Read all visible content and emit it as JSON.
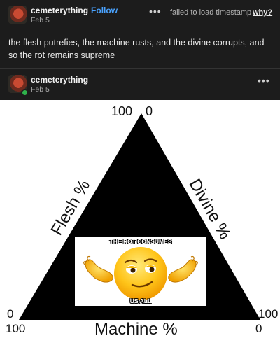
{
  "post1": {
    "username": "cemeterything",
    "follow_label": "Follow",
    "date": "Feb 5",
    "menu_label": "•••",
    "timestamp_status": "failed to load timestamp",
    "why_link": "why?",
    "text": "the flesh putrefies, the machine rusts, and the divine corrupts, and so the rot remains supreme"
  },
  "post2": {
    "username": "cemeterything",
    "date": "Feb 5",
    "menu_label": "•••"
  },
  "meme": {
    "top_value": "100",
    "top_zero": "0",
    "left_axis": "Flesh %",
    "right_axis": "Divine %",
    "bottom_axis": "Machine %",
    "left_zero": "0",
    "right_hundred": "100",
    "bottom_left_hundred": "100",
    "bottom_right_zero": "0",
    "caption_top": "THE ROT CONSUMES",
    "caption_bottom": "US ALL"
  },
  "colors": {
    "background": "#1c1c1c",
    "link": "#4aa3ff",
    "badge": "#2fb24b"
  }
}
